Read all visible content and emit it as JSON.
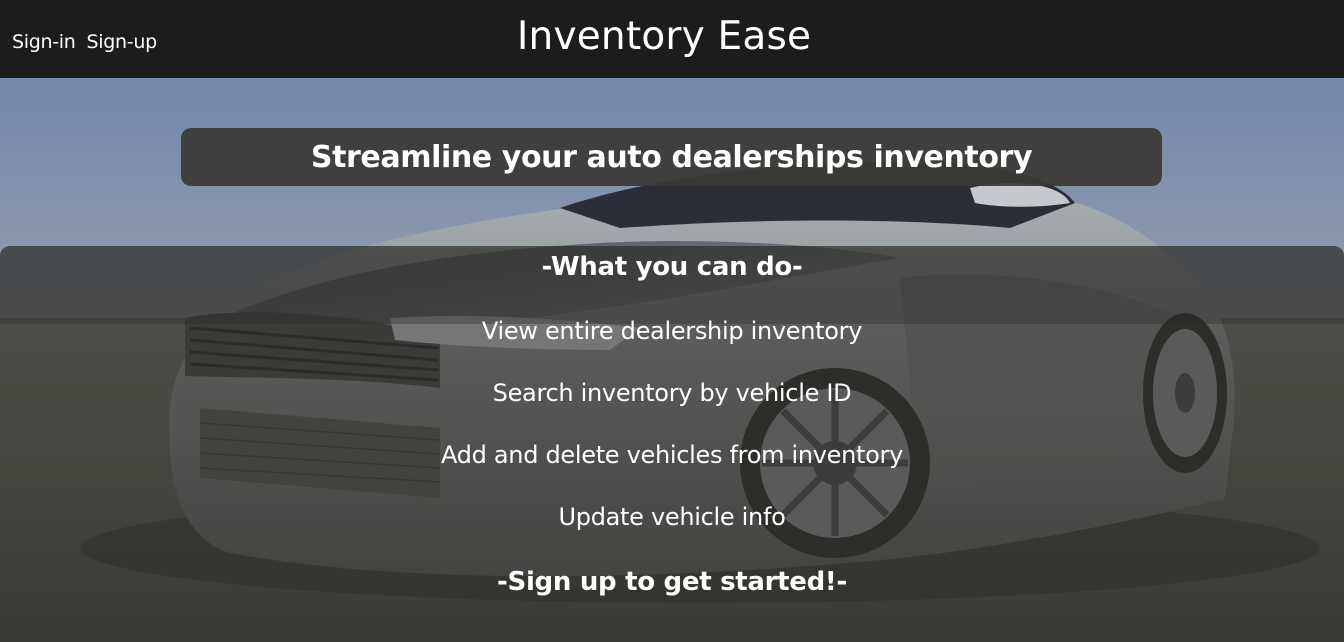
{
  "navbar": {
    "title": "Inventory Ease",
    "links": [
      {
        "label": "Sign-in"
      },
      {
        "label": "Sign-up"
      }
    ]
  },
  "hero": {
    "tagline": "Streamline your auto dealerships inventory",
    "background_image": "silver sports car"
  },
  "features": {
    "heading": "-What you can do-",
    "items": [
      "View entire dealership inventory",
      "Search inventory by vehicle ID",
      "Add and delete vehicles from inventory",
      "Update vehicle info"
    ],
    "signup_heading": "-Sign up to get started!-"
  },
  "colors": {
    "navbar_bg": "#1c1c1c",
    "panel_bg": "#3a3a36",
    "text": "#ffffff",
    "sky": "#6f85a8",
    "floor": "#54524a"
  }
}
